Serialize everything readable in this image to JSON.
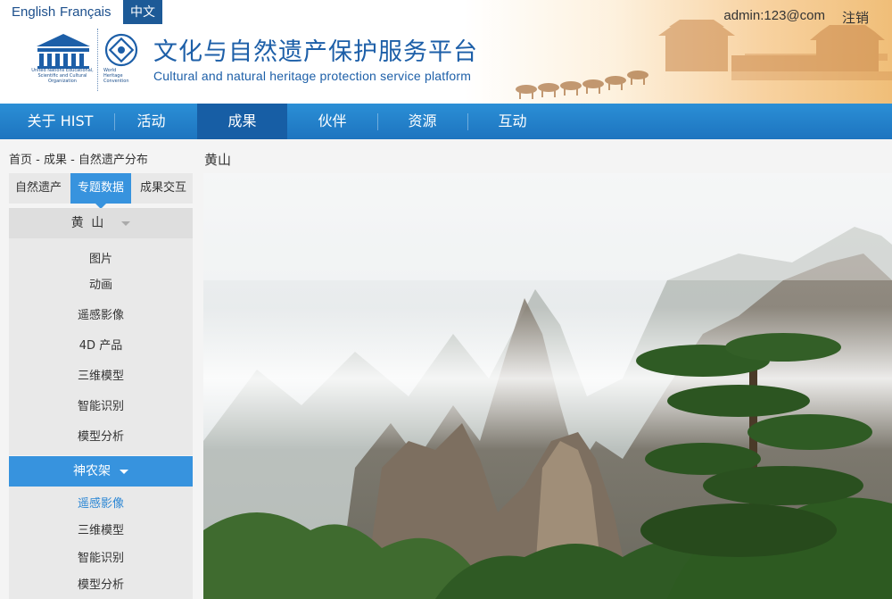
{
  "language_switch": {
    "english": "English",
    "french": "Français",
    "chinese": "中文"
  },
  "user": {
    "account": "admin:123@com",
    "logout": "注销"
  },
  "branding": {
    "title_zh": "文化与自然遗产保护服务平台",
    "title_en": "Cultural and natural heritage protection service platform",
    "unesco_mark": "UNESCO",
    "unesco_caption": "United Nations Educational, Scientific and Cultural Organization",
    "whc_caption": "World Heritage Convention"
  },
  "nav": {
    "items": [
      {
        "label": "关于 HIST"
      },
      {
        "label": "活动"
      },
      {
        "label": "成果"
      },
      {
        "label": "伙伴"
      },
      {
        "label": "资源"
      },
      {
        "label": "互动"
      }
    ],
    "active_index": 2
  },
  "breadcrumb": "首页 - 成果 - 自然遗产分布",
  "sub_tabs": {
    "items": [
      {
        "label": "自然遗产"
      },
      {
        "label": "专题数据"
      },
      {
        "label": "成果交互"
      }
    ],
    "active_index": 1
  },
  "sites": [
    {
      "name": "黄 山",
      "expanded": false,
      "items": [
        {
          "label": "图片"
        },
        {
          "label": "动画"
        },
        {
          "label": "遥感影像"
        },
        {
          "label": "4D 产品"
        },
        {
          "label": "三维模型"
        },
        {
          "label": "智能识别"
        },
        {
          "label": "模型分析"
        }
      ]
    },
    {
      "name": "神农架",
      "expanded": true,
      "items": [
        {
          "label": "遥感影像",
          "current": true
        },
        {
          "label": "三维模型"
        },
        {
          "label": "智能识别"
        },
        {
          "label": "模型分析"
        }
      ]
    }
  ],
  "content": {
    "title": "黄山",
    "image_subject": "huangshan-mountain-photo"
  },
  "colors": {
    "brand_blue": "#1d5fa8",
    "nav_blue": "#2483cc",
    "nav_active": "#175ea5",
    "accent_blue": "#3793de",
    "current_link": "#2b86d4"
  }
}
